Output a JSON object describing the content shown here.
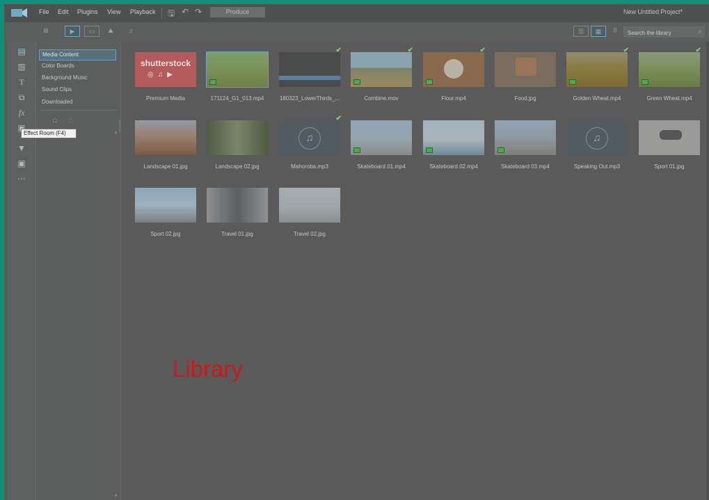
{
  "menu": {
    "items": [
      "File",
      "Edit",
      "Plugins",
      "View",
      "Playback"
    ],
    "produce_label": "Produce",
    "project_title": "New Untitled Project*"
  },
  "toolbar": {
    "search_placeholder": "Search the library"
  },
  "categories": [
    {
      "label": "Media Content",
      "selected": true
    },
    {
      "label": "Color Boards",
      "selected": false
    },
    {
      "label": "Background Music",
      "selected": false
    },
    {
      "label": "Sound Clips",
      "selected": false
    },
    {
      "label": "Downloaded",
      "selected": false
    }
  ],
  "tooltip": "Effect Room (F4)",
  "media": [
    {
      "name": "Premium Media",
      "kind": "shutterstock"
    },
    {
      "name": "171124_G1_013.mp4",
      "kind": "video",
      "selected": true
    },
    {
      "name": "180323_LowerThirds_...",
      "kind": "video",
      "checked": true
    },
    {
      "name": "Combine.mov",
      "kind": "video",
      "checked": true
    },
    {
      "name": "Flour.mp4",
      "kind": "video",
      "checked": true
    },
    {
      "name": "Food.jpg",
      "kind": "image"
    },
    {
      "name": "Golden Wheat.mp4",
      "kind": "video",
      "checked": true
    },
    {
      "name": "Green Wheat.mp4",
      "kind": "video",
      "checked": true
    },
    {
      "name": "Landscape 01.jpg",
      "kind": "image"
    },
    {
      "name": "Landscape 02.jpg",
      "kind": "image"
    },
    {
      "name": "Mahoroba.mp3",
      "kind": "audio",
      "checked": true
    },
    {
      "name": "Skateboard 01.mp4",
      "kind": "video"
    },
    {
      "name": "Skateboard 02.mp4",
      "kind": "video"
    },
    {
      "name": "Skateboard 03.mp4",
      "kind": "video"
    },
    {
      "name": "Speaking Out.mp3",
      "kind": "audio"
    },
    {
      "name": "Sport 01.jpg",
      "kind": "image"
    },
    {
      "name": "Sport 02.jpg",
      "kind": "image"
    },
    {
      "name": "Travel 01.jpg",
      "kind": "image"
    },
    {
      "name": "Travel 02.jpg",
      "kind": "image"
    }
  ],
  "shutterstock_text": "shutterstock",
  "library_label": "Library"
}
